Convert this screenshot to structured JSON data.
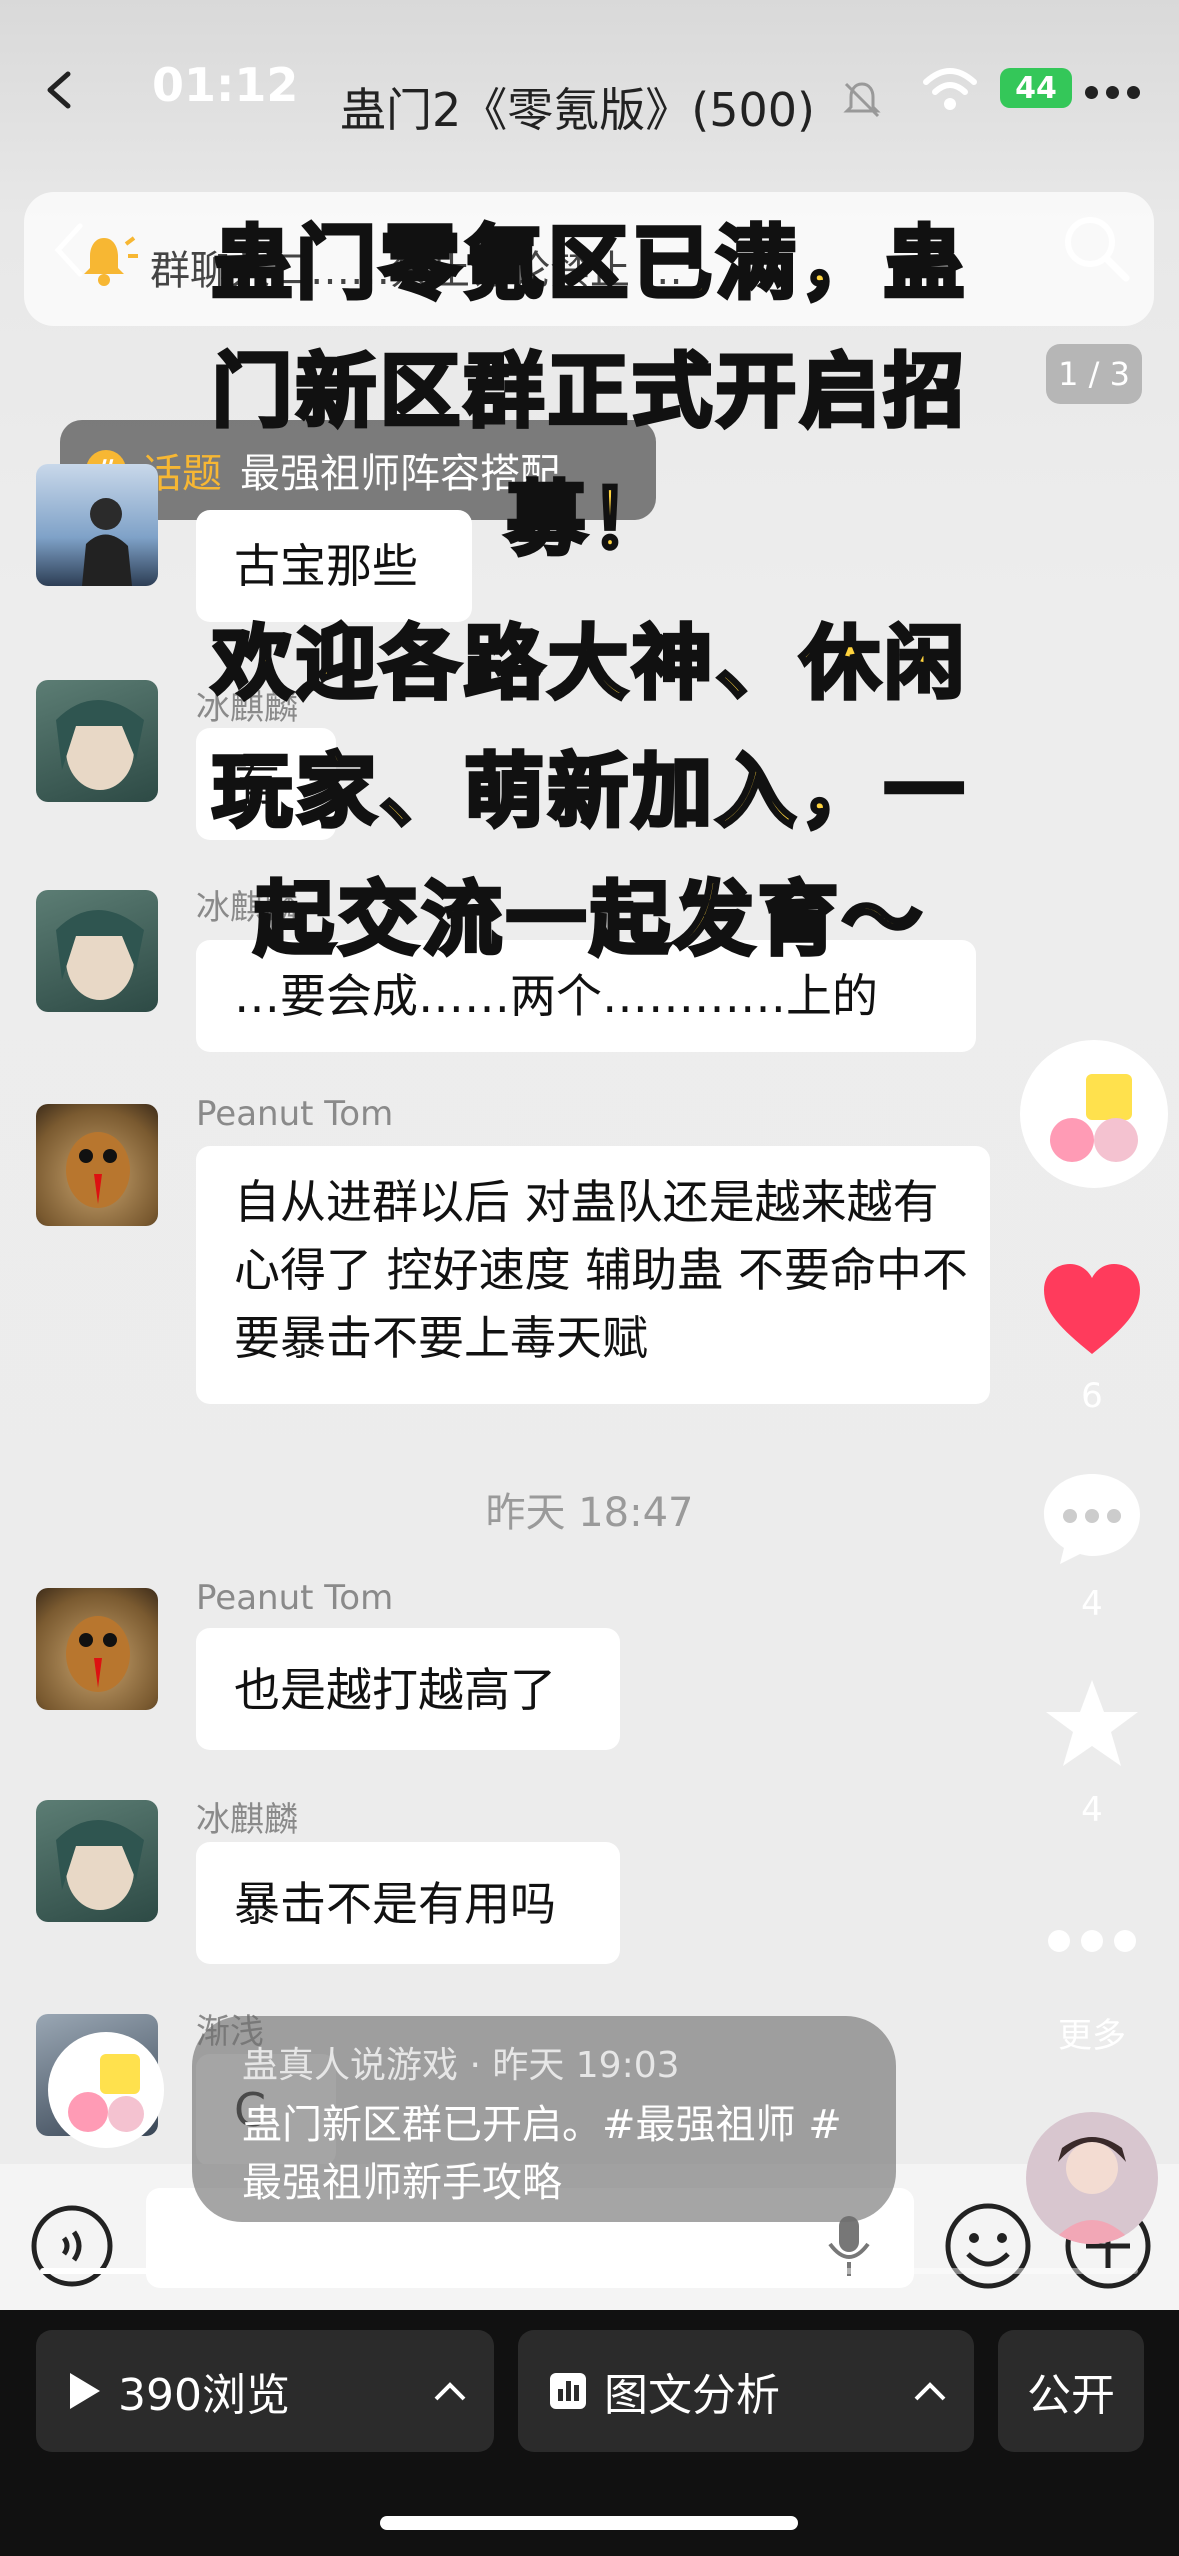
{
  "status": {
    "time": "01:12",
    "battery": "44",
    "chat_title": "蛊门2《零氪版》(500)"
  },
  "notice_text": "群聊入口……禁止讨论禁止 …",
  "image_counter": "1 / 3",
  "topic": {
    "label": "话题",
    "text": "最强祖师阵容搭配"
  },
  "overlay_lines": [
    "蛊门零氪区已满，蛊",
    "门新区群正式开启招",
    "募！",
    "欢迎各路大神、休闲",
    "玩家、萌新加入，一",
    "起交流一起发育～"
  ],
  "messages": [
    {
      "sender": "",
      "text": "古宝那些"
    },
    {
      "sender": "冰麒麟",
      "text": "有"
    },
    {
      "sender": "冰麒麟",
      "text": "…要会成……两个…………上的"
    },
    {
      "sender": "Peanut Tom",
      "text": "自从进群以后 对蛊队还是越来越有心得了 控好速度 辅助蛊 不要命中不要暴击不要上毒天赋"
    },
    {
      "sender": "Peanut Tom",
      "text": "也是越打越高了"
    },
    {
      "sender": "冰麒麟",
      "text": "暴击不是有用吗"
    },
    {
      "sender": "渐浅",
      "text": "C"
    }
  ],
  "time_separator": "昨天 18:47",
  "side": {
    "likes": "6",
    "comments": "4",
    "favorites": "4",
    "more_label": "更多"
  },
  "caption": {
    "author": "蛊真人说游戏 · 昨天 19:03",
    "text": "蛊门新区群已开启。#最强祖师 #最强祖师新手攻略"
  },
  "bottom": {
    "views": "390浏览",
    "analysis": "图文分析",
    "visibility": "公开"
  },
  "colors": {
    "overlay_yellow": "#ffd33d",
    "like_red": "#ff3b5c",
    "topic_orange": "#f7b733",
    "battery_green": "#34c759"
  }
}
